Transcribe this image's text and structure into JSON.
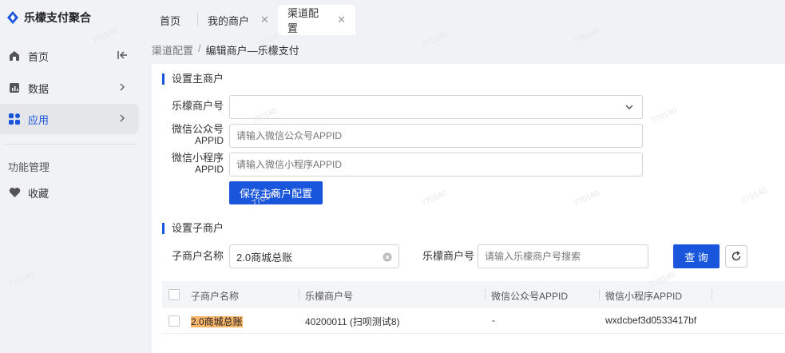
{
  "app": {
    "title": "乐檬支付聚合"
  },
  "sidebar": {
    "items": [
      {
        "label": "首页"
      },
      {
        "label": "数据"
      },
      {
        "label": "应用"
      }
    ],
    "group_title": "功能管理",
    "group_items": [
      {
        "label": "收藏"
      }
    ]
  },
  "tabs": [
    {
      "label": "首页"
    },
    {
      "label": "我的商户"
    },
    {
      "label": "渠道配置"
    }
  ],
  "breadcrumb": {
    "parent": "渠道配置",
    "separator": "/",
    "current": "编辑商户—乐檬支付"
  },
  "main_merchant": {
    "title": "设置主商户",
    "merchant_label": "乐檬商户号",
    "merchant_value": "",
    "wx_official_label_1": "微信公众号",
    "wx_official_label_2": "APPID",
    "wx_official_placeholder": "请输入微信公众号APPID",
    "wx_mini_label_1": "微信小程序",
    "wx_mini_label_2": "APPID",
    "wx_mini_placeholder": "请输入微信小程序APPID",
    "save_button": "保存主商户配置"
  },
  "sub_merchant": {
    "title": "设置子商户",
    "name_label": "子商户名称",
    "name_value": "2.0商城总账",
    "merchant_label": "乐檬商户号",
    "merchant_placeholder": "请输入乐檬商户号搜索",
    "query_button": "查 询"
  },
  "table": {
    "columns": [
      "子商户名称",
      "乐檬商户号",
      "微信公众号APPID",
      "微信小程序APPID"
    ],
    "rows": [
      {
        "name": "2.0商城总账",
        "merchant": "40200011 (扫呗测试8)",
        "wx_official": "-",
        "wx_mini": "wxdcbef3d0533417bf"
      }
    ]
  },
  "colors": {
    "accent": "#1a56db",
    "highlight": "#f7b46b"
  },
  "watermark": "770140"
}
